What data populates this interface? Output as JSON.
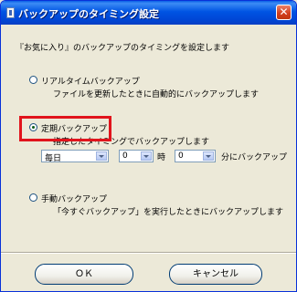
{
  "window": {
    "title": "バックアップのタイミング設定",
    "close_glyph": "✕"
  },
  "intro": "『お気に入り』のバックアップのタイミングを設定します",
  "options": {
    "realtime": {
      "label": "リアルタイムバックアップ",
      "desc": "ファイルを更新したときに自動的にバックアップします",
      "checked": false
    },
    "scheduled": {
      "label": "定期バックアップ",
      "desc": "指定したタイミングでバックアップします",
      "checked": true,
      "frequency": "毎日",
      "hour": "0",
      "hour_unit": "時",
      "minute": "0",
      "minute_unit": "分にバックアップ"
    },
    "manual": {
      "label": "手動バックアップ",
      "desc": "「今すぐバックアップ」を実行したときにバックアップします",
      "checked": false
    }
  },
  "buttons": {
    "ok": "ＯＫ",
    "cancel": "キャンセル"
  },
  "colors": {
    "highlight": "#e1141c",
    "titlebar": "#0054e3"
  }
}
